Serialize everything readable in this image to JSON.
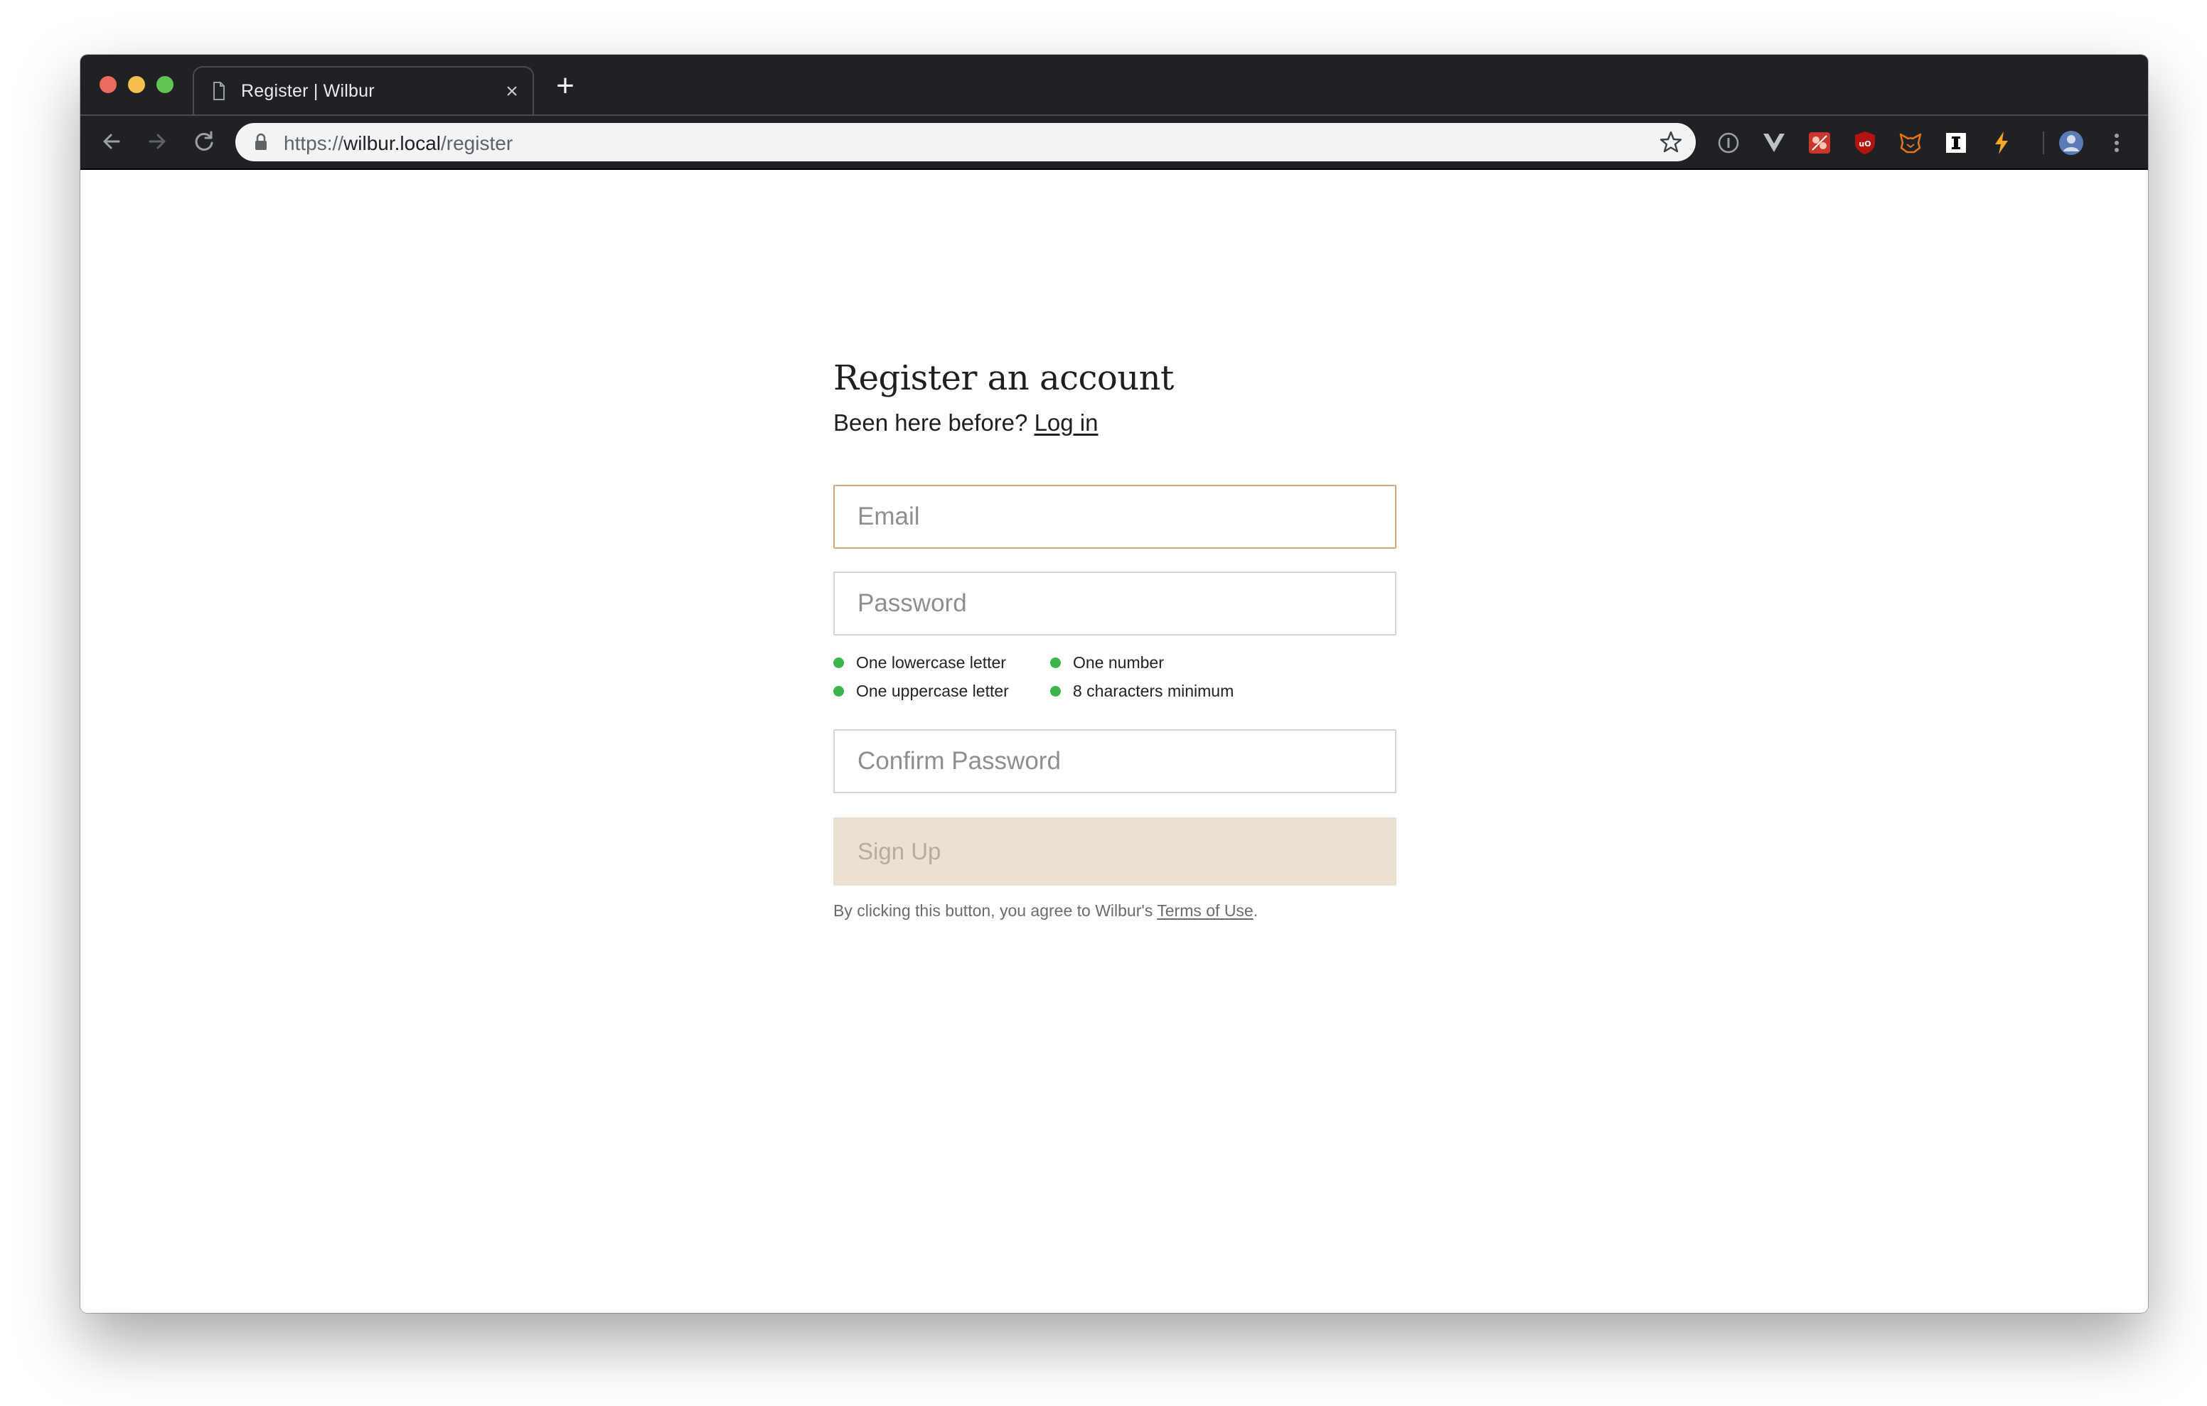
{
  "browser": {
    "tab": {
      "title": "Register | Wilbur",
      "close_glyph": "×"
    },
    "new_tab_glyph": "+",
    "url": {
      "scheme": "https://",
      "host": "wilbur.local",
      "path": "/register"
    },
    "nav_icons": [
      "back-arrow-icon",
      "forward-arrow-icon",
      "reload-icon"
    ],
    "extension_icons": [
      "info-icon",
      "vue-devtools-icon",
      "extension-red-icon",
      "ublock-origin-icon",
      "metamask-fox-icon",
      "instapaper-icon",
      "lightning-icon",
      "profile-avatar-icon",
      "menu-dots-icon"
    ]
  },
  "page": {
    "heading": "Register an account",
    "login_prompt": "Been here before?",
    "login_link": "Log in",
    "email": {
      "placeholder": "Email",
      "value": ""
    },
    "password": {
      "placeholder": "Password",
      "value": ""
    },
    "password_rules": [
      {
        "label": "One lowercase letter",
        "status_color": "#3bb54a"
      },
      {
        "label": "One number",
        "status_color": "#3bb54a"
      },
      {
        "label": "One uppercase letter",
        "status_color": "#3bb54a"
      },
      {
        "label": "8 characters minimum",
        "status_color": "#3bb54a"
      }
    ],
    "confirm_password": {
      "placeholder": "Confirm Password",
      "value": ""
    },
    "signup_button": "Sign Up",
    "terms_prefix": "By clicking this button, you agree to Wilbur's",
    "terms_link": "Terms of Use",
    "terms_suffix": "."
  },
  "colors": {
    "accent_focus": "#d7a877",
    "button_disabled_bg": "#ece0d3",
    "rule_ok": "#3bb54a"
  }
}
